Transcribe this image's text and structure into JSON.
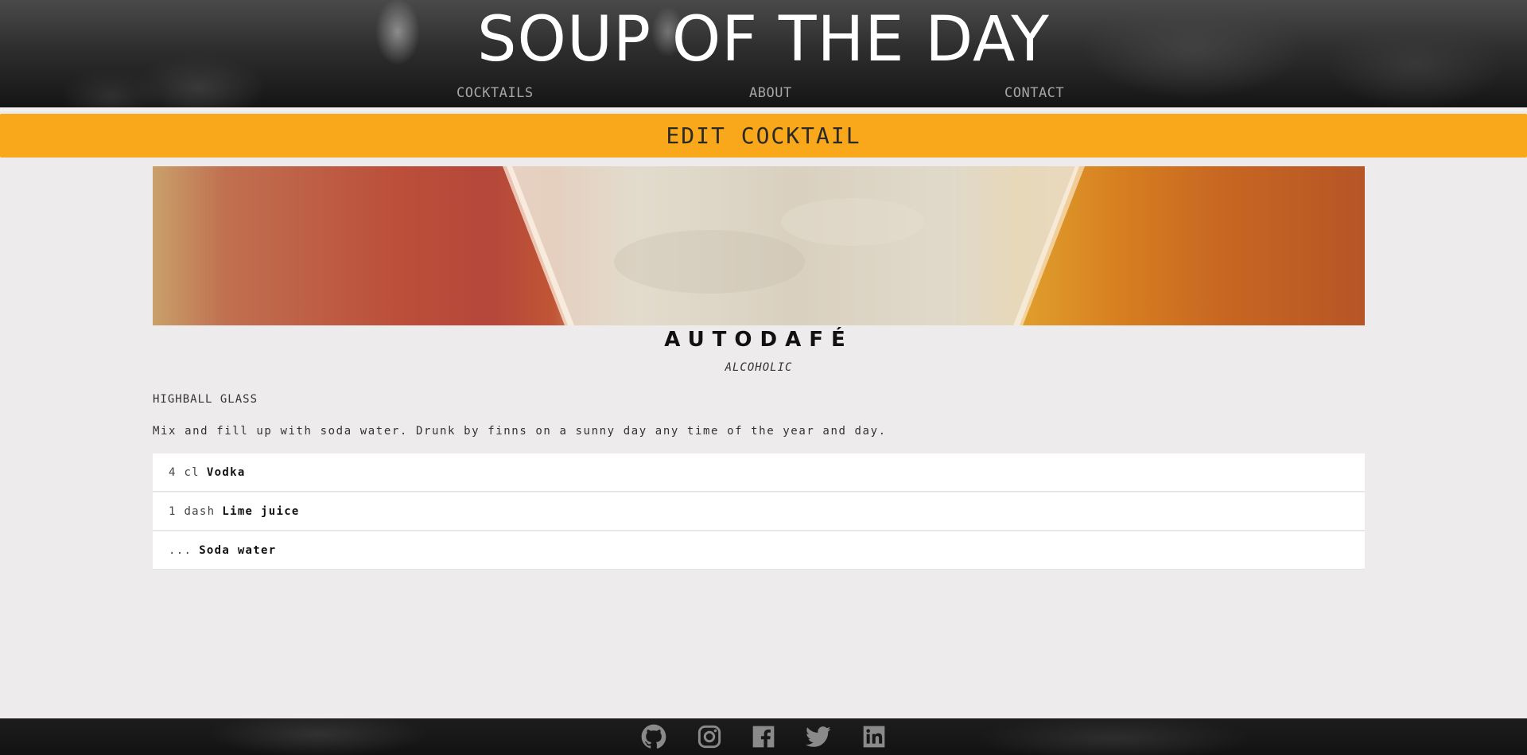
{
  "header": {
    "site_title": "SOUP OF THE DAY",
    "nav": {
      "cocktails": "COCKTAILS",
      "about": "ABOUT",
      "contact": "CONTACT"
    }
  },
  "banner": {
    "title": "EDIT COCKTAIL"
  },
  "cocktail": {
    "name": "AUTODAFÉ",
    "category": "ALCOHOLIC",
    "glass": "HIGHBALL GLASS",
    "instructions": "Mix and fill up with soda water. Drunk by finns on a sunny day any time of the year and day.",
    "ingredients": [
      {
        "measure": "4 cl",
        "name": "Vodka"
      },
      {
        "measure": "1 dash",
        "name": "Lime juice"
      },
      {
        "measure": "...",
        "name": "Soda water"
      }
    ]
  },
  "footer": {
    "icons": [
      "github-icon",
      "instagram-icon",
      "facebook-icon",
      "twitter-icon",
      "linkedin-icon"
    ]
  },
  "colors": {
    "accent": "#f8a81a",
    "page_background": "#eeebec",
    "header_text": "#ffffff",
    "nav_text": "#a6a6a6",
    "footer_icons": "#8a8a8a"
  }
}
